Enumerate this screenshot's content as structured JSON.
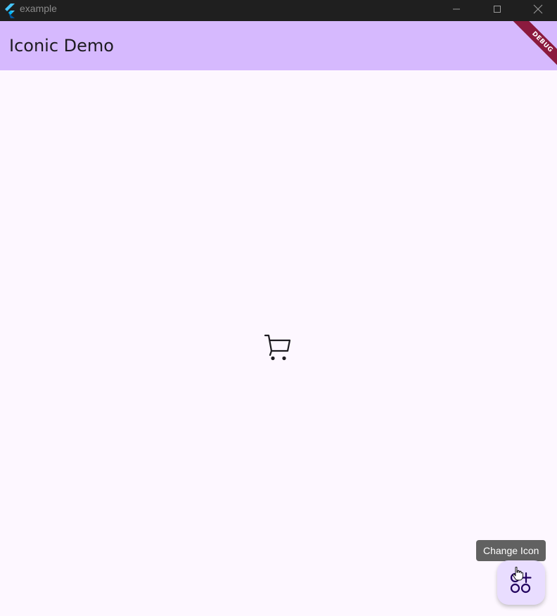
{
  "window": {
    "title": "example",
    "controls": {
      "minimize": "minimize-icon",
      "maximize": "maximize-icon",
      "close": "close-icon"
    }
  },
  "appbar": {
    "title": "Iconic Demo",
    "background": "#d6b9fe",
    "debug_banner": "DEBUG"
  },
  "main": {
    "icon": "shopping-cart-icon",
    "background": "#fdf7ff"
  },
  "fab": {
    "icon": "apps-add-icon",
    "tooltip": "Change Icon",
    "background": "#e9ddff"
  }
}
